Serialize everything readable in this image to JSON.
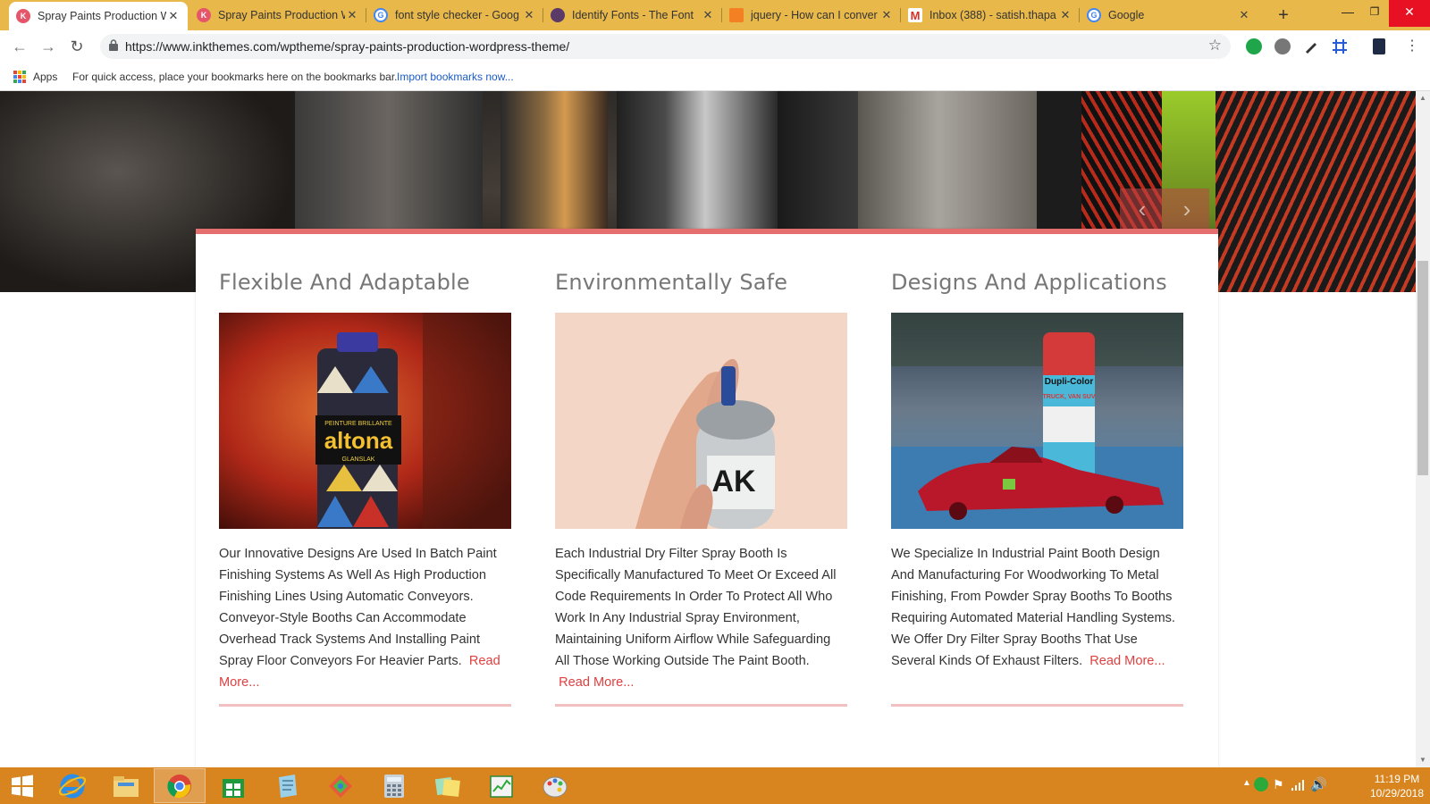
{
  "browser": {
    "tabs": [
      {
        "title": "Spray Paints Production W",
        "favicon": "inkthemes-icon",
        "active": true
      },
      {
        "title": "Spray Paints Production W",
        "favicon": "inkthemes-icon",
        "active": false
      },
      {
        "title": "font style checker - Goog",
        "favicon": "google-icon",
        "active": false
      },
      {
        "title": "Identify Fonts - The Font",
        "favicon": "fontsquirrel-icon",
        "active": false
      },
      {
        "title": "jquery - How can I conver",
        "favicon": "stackoverflow-icon",
        "active": false
      },
      {
        "title": "Inbox (388) - satish.thapa",
        "favicon": "gmail-icon",
        "active": false
      },
      {
        "title": "Google",
        "favicon": "google-icon",
        "active": false
      }
    ],
    "url": "https://www.inkthemes.com/wptheme/spray-paints-production-wordpress-theme/",
    "bookmarks": {
      "apps_label": "Apps",
      "hint": "For quick access, place your bookmarks here on the bookmarks bar.",
      "import_link": "Import bookmarks now..."
    }
  },
  "page": {
    "accent_color": "#e56e6e",
    "columns": [
      {
        "heading": "Flexible And Adaptable",
        "image": "spray-can-altona-image",
        "image_label_1": "PEINTURE BRILLANTE",
        "image_label_2": "altona",
        "image_label_3": "GLANSLAK",
        "body": "Our Innovative Designs Are Used In Batch Paint Finishing Systems As Well As High Production Finishing Lines Using Automatic Conveyors. Conveyor-Style Booths Can Accommodate Overhead Track Systems And Installing Paint Spray Floor Conveyors For Heavier Parts.",
        "read_more": "Read More..."
      },
      {
        "heading": "Environmentally Safe",
        "image": "hand-spraying-can-image",
        "image_label_1": "AK",
        "body": "Each Industrial Dry Filter Spray Booth Is Specifically Manufactured To Meet Or Exceed All Code Requirements In Order To Protect All Who Work In Any Industrial Spray Environment, Maintaining Uniform Airflow While Safeguarding All Those Working Outside The Paint Booth.",
        "read_more": "Read More..."
      },
      {
        "heading": "Designs And Applications",
        "image": "dupli-color-can-car-model-image",
        "image_label_1": "Dupli-Color",
        "image_label_2": "TRUCK, VAN SUV",
        "body": "We Specialize In Industrial Paint Booth Design And Manufacturing For Woodworking To Metal Finishing, From Powder Spray Booths To Booths Requiring Automated Material Handling Systems. We Offer Dry Filter Spray Booths That Use Several Kinds Of Exhaust Filters.",
        "read_more": "Read More..."
      }
    ]
  },
  "taskbar": {
    "items": [
      "start-icon",
      "internet-explorer-icon",
      "file-explorer-icon",
      "chrome-icon",
      "store-icon",
      "notepad-icon",
      "paint-app-icon",
      "calculator-icon",
      "sticky-notes-icon",
      "task-manager-icon",
      "paint-palette-icon"
    ],
    "time": "11:19 PM",
    "date": "10/29/2018"
  }
}
